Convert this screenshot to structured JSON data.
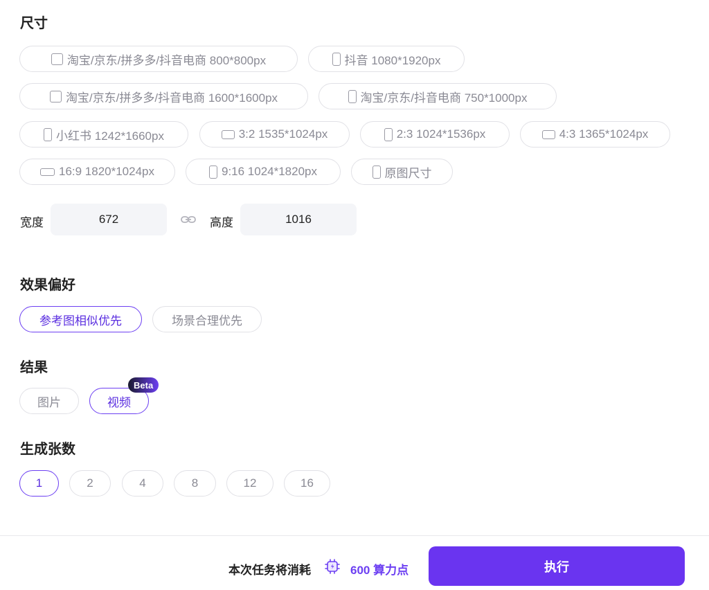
{
  "size_section": {
    "title": "尺寸",
    "options": [
      {
        "label": "淘宝/京东/拼多多/抖音电商 800*800px",
        "icon": "square-icon"
      },
      {
        "label": "抖音 1080*1920px",
        "icon": "portrait-icon"
      },
      {
        "label": "淘宝/京东/拼多多/抖音电商 1600*1600px",
        "icon": "square-icon"
      },
      {
        "label": "淘宝/京东/抖音电商 750*1000px",
        "icon": "portrait-icon"
      },
      {
        "label": "小红书 1242*1660px",
        "icon": "portrait-icon"
      },
      {
        "label": "3:2 1535*1024px",
        "icon": "landscape-icon"
      },
      {
        "label": "2:3 1024*1536px",
        "icon": "portrait-icon"
      },
      {
        "label": "4:3 1365*1024px",
        "icon": "landscape-icon"
      },
      {
        "label": "16:9 1820*1024px",
        "icon": "wide-icon"
      },
      {
        "label": "9:16 1024*1820px",
        "icon": "portrait-icon"
      },
      {
        "label": "原图尺寸",
        "icon": "portrait-icon"
      }
    ],
    "width_label": "宽度",
    "width_value": "672",
    "height_label": "高度",
    "height_value": "1016"
  },
  "preference_section": {
    "title": "效果偏好",
    "options": [
      "参考图相似优先",
      "场景合理优先"
    ],
    "selected": "参考图相似优先"
  },
  "result_section": {
    "title": "结果",
    "options": [
      "图片",
      "视频"
    ],
    "selected": "视频",
    "badge": "Beta"
  },
  "count_section": {
    "title": "生成张数",
    "options": [
      "1",
      "2",
      "4",
      "8",
      "12",
      "16"
    ],
    "selected": "1"
  },
  "footer": {
    "cost_label": "本次任务将消耗",
    "cost_value": "600 算力点",
    "execute_label": "执行"
  },
  "colors": {
    "accent": "#6c3ff2",
    "chip_border": "#e1e1e6",
    "field_bg": "#f4f5f8"
  }
}
